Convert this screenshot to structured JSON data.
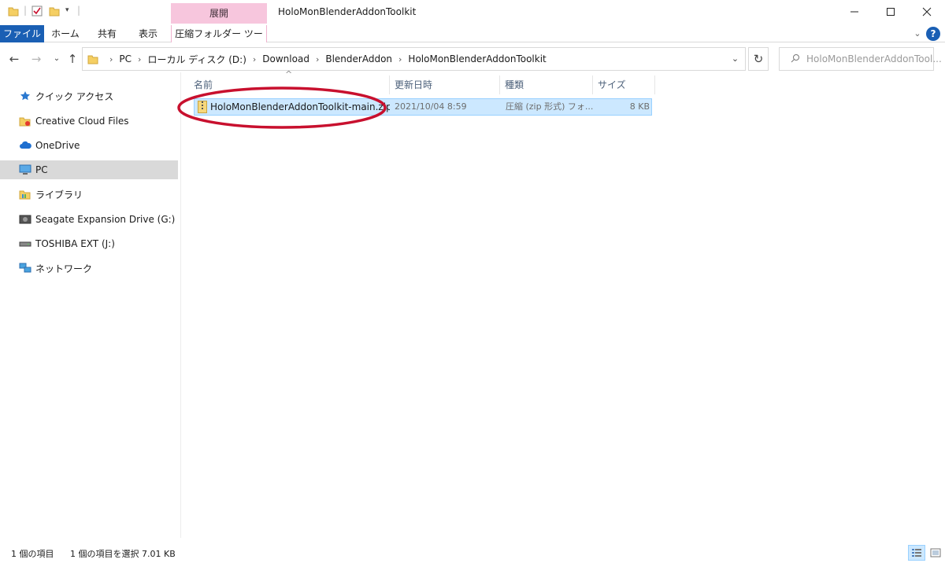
{
  "window": {
    "title": "HoloMonBlenderAddonToolkit",
    "context_tab_group": "展開"
  },
  "ribbon": {
    "tabs": [
      {
        "label": "ファイル"
      },
      {
        "label": "ホーム"
      },
      {
        "label": "共有"
      },
      {
        "label": "表示"
      },
      {
        "label": "圧縮フォルダー ツール"
      }
    ],
    "help_label": "?"
  },
  "address": {
    "breadcrumbs": [
      "PC",
      "ローカル ディスク (D:)",
      "Download",
      "BlenderAddon",
      "HoloMonBlenderAddonToolkit"
    ],
    "search_placeholder": "HoloMonBlenderAddonTool..."
  },
  "nav_pane": {
    "items": [
      {
        "label": "クイック アクセス",
        "icon": "star-icon"
      },
      {
        "label": "Creative Cloud Files",
        "icon": "creative-cloud-folder-icon"
      },
      {
        "label": "OneDrive",
        "icon": "cloud-icon"
      },
      {
        "label": "PC",
        "icon": "computer-icon",
        "selected": true
      },
      {
        "label": "ライブラリ",
        "icon": "library-icon"
      },
      {
        "label": "Seagate Expansion Drive (G:)",
        "icon": "drive-icon"
      },
      {
        "label": "TOSHIBA EXT (J:)",
        "icon": "usb-drive-icon"
      },
      {
        "label": "ネットワーク",
        "icon": "network-icon"
      }
    ]
  },
  "file_list": {
    "columns": [
      {
        "label": "名前"
      },
      {
        "label": "更新日時"
      },
      {
        "label": "種類"
      },
      {
        "label": "サイズ"
      }
    ],
    "sort_indicator": "^",
    "rows": [
      {
        "name": "HoloMonBlenderAddonToolkit-main.zip",
        "modified": "2021/10/04 8:59",
        "type": "圧縮 (zip 形式) フォ...",
        "size": "8 KB",
        "selected": true
      }
    ],
    "highlight_color": "#c8102e"
  },
  "status_bar": {
    "item_count": "1 個の項目",
    "selection": "1 個の項目を選択  7.01 KB"
  },
  "colors": {
    "accent": "#1a5fb4",
    "context_tab": "#f7c6dd",
    "selection": "#cce8ff"
  }
}
